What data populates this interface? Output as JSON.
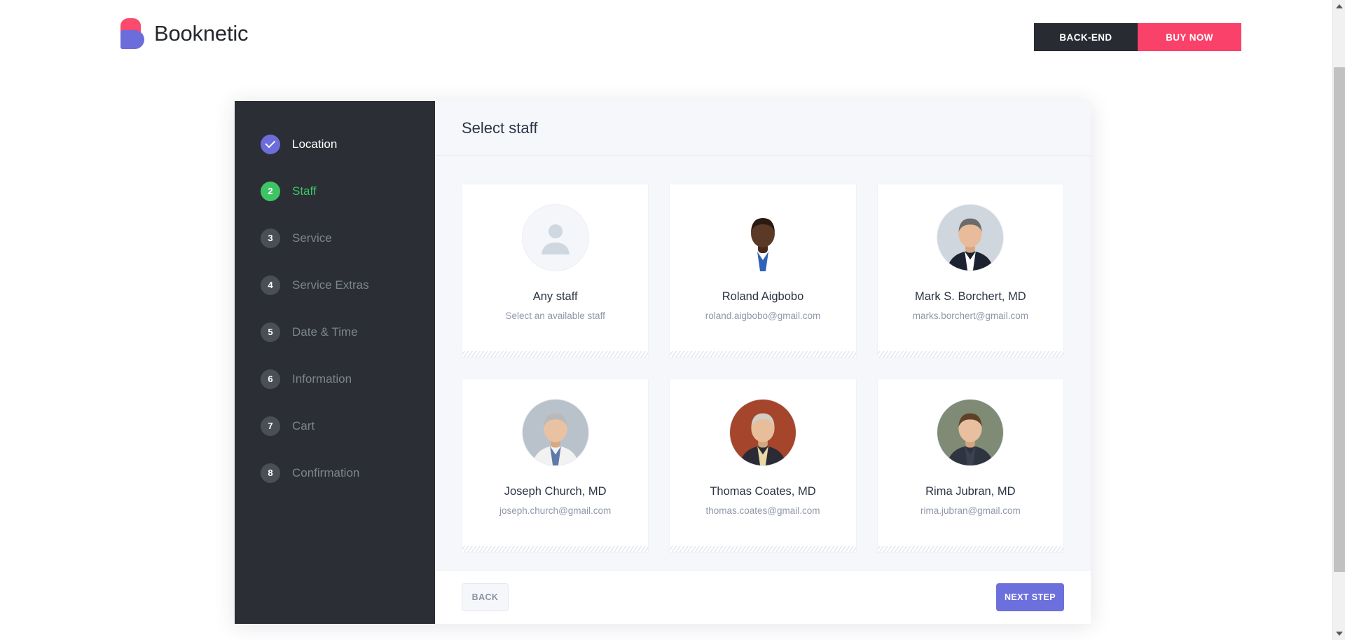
{
  "header": {
    "brand_name": "Booknetic",
    "backend_label": "BACK-END",
    "buy_now_label": "BUY NOW",
    "backend_color": "#282c32",
    "buy_now_color": "#fa4169",
    "logo_top_color": "#fa4a6d",
    "logo_bottom_color": "#6c6cdb"
  },
  "steps": [
    {
      "number": "1",
      "label": "Location",
      "state": "done",
      "glyph": "check"
    },
    {
      "number": "2",
      "label": "Staff",
      "state": "current",
      "glyph": "number"
    },
    {
      "number": "3",
      "label": "Service",
      "state": "pending",
      "glyph": "number"
    },
    {
      "number": "4",
      "label": "Service Extras",
      "state": "pending",
      "glyph": "number"
    },
    {
      "number": "5",
      "label": "Date & Time",
      "state": "pending",
      "glyph": "number"
    },
    {
      "number": "6",
      "label": "Information",
      "state": "pending",
      "glyph": "number"
    },
    {
      "number": "7",
      "label": "Cart",
      "state": "pending",
      "glyph": "number"
    },
    {
      "number": "8",
      "label": "Confirmation",
      "state": "pending",
      "glyph": "number"
    }
  ],
  "step_colors": {
    "done": "#6c6cdb",
    "current": "#3ec465",
    "pending": "#4a4f57"
  },
  "panel": {
    "title": "Select staff",
    "staff": [
      {
        "name": "Any staff",
        "sub": "Select an available staff",
        "avatar": "person-placeholder-icon"
      },
      {
        "name": "Roland Aigbobo",
        "sub": "roland.aigbobo@gmail.com",
        "avatar": "photo-roland"
      },
      {
        "name": "Mark S. Borchert, MD",
        "sub": "marks.borchert@gmail.com",
        "avatar": "photo-mark"
      },
      {
        "name": "Joseph Church, MD",
        "sub": "joseph.church@gmail.com",
        "avatar": "photo-joseph"
      },
      {
        "name": "Thomas Coates, MD",
        "sub": "thomas.coates@gmail.com",
        "avatar": "photo-thomas"
      },
      {
        "name": "Rima Jubran, MD",
        "sub": "rima.jubran@gmail.com",
        "avatar": "photo-rima"
      }
    ]
  },
  "footer": {
    "back_label": "BACK",
    "next_label": "NEXT STEP",
    "next_color": "#6c70dd"
  }
}
